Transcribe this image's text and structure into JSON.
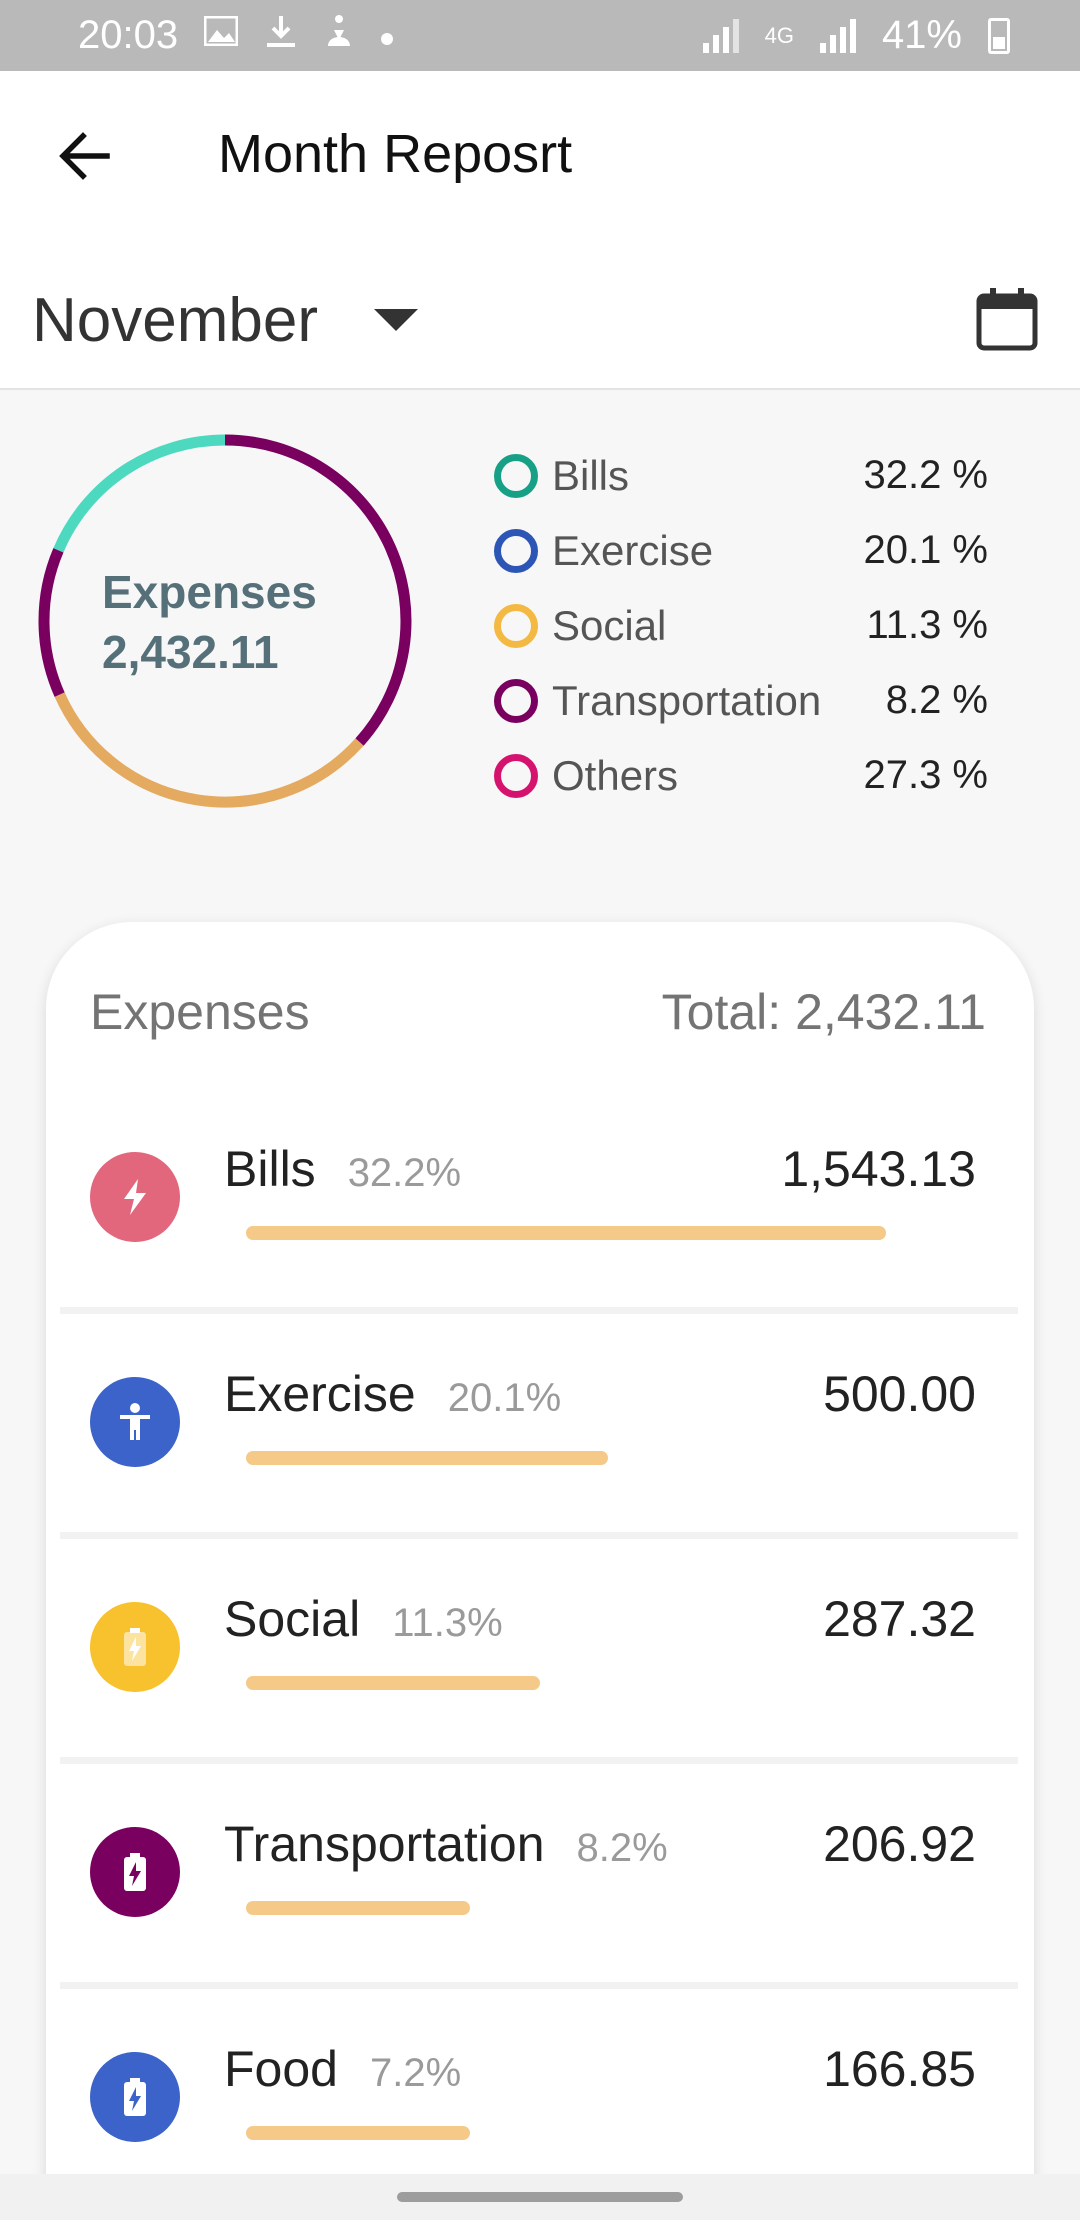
{
  "status_bar": {
    "time": "20:03",
    "network": "4G",
    "battery": "41%"
  },
  "app_bar": {
    "title": "Month Reposrt",
    "back_icon": "arrow-left-icon"
  },
  "month_selector": {
    "month": "November",
    "dropdown_icon": "triangle-down-icon",
    "calendar_icon": "calendar-icon"
  },
  "summary": {
    "center_label": "Expenses",
    "center_value": "2,432.11",
    "legend": [
      {
        "name": "Bills",
        "pct": "32.2 %",
        "color": "#16a085"
      },
      {
        "name": "Exercise",
        "pct": "20.1 %",
        "color": "#2d55b5"
      },
      {
        "name": "Social",
        "pct": "11.3 %",
        "color": "#f4b942"
      },
      {
        "name": "Transportation",
        "pct": "8.2 %",
        "color": "#7a0060"
      },
      {
        "name": "Others",
        "pct": "27.3 %",
        "color": "#d5126e"
      }
    ],
    "donut_colors": {
      "teal": "#4dd9c0",
      "purple": "#7a0060",
      "orange": "#e3aa60"
    }
  },
  "expenses": {
    "title": "Expenses",
    "total": "Total: 2,432.11",
    "items": [
      {
        "name": "Bills",
        "pct": "32.2%",
        "amount": "1,543.13",
        "fraction": 1.0,
        "icon": "lightning-icon",
        "color": "#e2677d"
      },
      {
        "name": "Exercise",
        "pct": "20.1%",
        "amount": "500.00",
        "fraction": 0.566,
        "icon": "person-icon",
        "color": "#3b63c9"
      },
      {
        "name": "Social",
        "pct": "11.3%",
        "amount": "287.32",
        "fraction": 0.459,
        "icon": "battery-icon",
        "color": "#f8c22e"
      },
      {
        "name": "Transportation",
        "pct": "8.2%",
        "amount": "206.92",
        "fraction": 0.35,
        "icon": "battery-icon",
        "color": "#7a0060"
      },
      {
        "name": "Food",
        "pct": "7.2%",
        "amount": "166.85",
        "fraction": 0.35,
        "icon": "battery-icon",
        "color": "#3b63c9"
      }
    ]
  }
}
